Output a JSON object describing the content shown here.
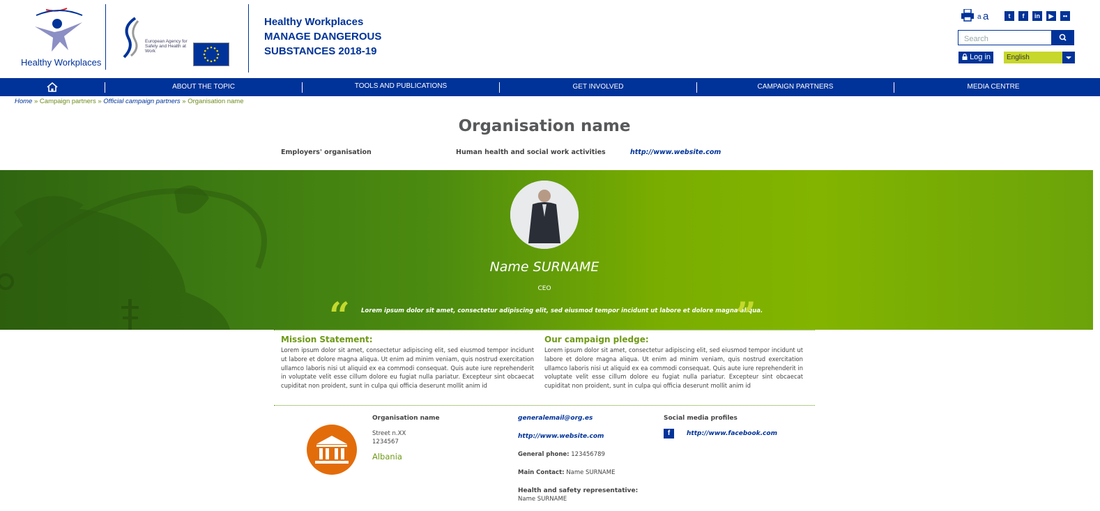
{
  "header": {
    "logo_text": "Healthy Workplaces",
    "agency_text": "European Agency for Safety and Health at Work",
    "campaign_line1": "Healthy Workplaces",
    "campaign_line2": "MANAGE DANGEROUS",
    "campaign_line3": "SUBSTANCES 2018-19",
    "font_small": "a",
    "font_large": "a",
    "search_placeholder": "Search",
    "login_label": "Log in",
    "language": "English",
    "social_icons": [
      "twitter-icon",
      "facebook-icon",
      "linkedin-icon",
      "youtube-icon",
      "flickr-icon"
    ]
  },
  "nav": {
    "items": [
      "ABOUT THE TOPIC",
      "TOOLS AND PUBLICATIONS",
      "GET INVOLVED",
      "CAMPAIGN PARTNERS",
      "MEDIA CENTRE"
    ]
  },
  "breadcrumb": {
    "home": "Home",
    "sep": "»",
    "campaign_partners": "Campaign partners",
    "official": "Official campaign partners",
    "current": "Organisation name"
  },
  "org": {
    "title": "Organisation name",
    "type": "Employers' organisation",
    "sector": "Human health and social work activities",
    "website": "http://www.website.com"
  },
  "banner": {
    "name": "Name SURNAME",
    "role": "CEO",
    "quote": "Lorem ipsum dolor sit amet, consectetur adipiscing elit, sed eiusmod tempor incidunt ut labore et dolore magna aliqua.",
    "open_quote": "“",
    "close_quote": "”"
  },
  "mission": {
    "heading": "Mission Statement:",
    "body": "Lorem ipsum dolor sit amet, consectetur adipiscing elit, sed eiusmod tempor incidunt ut labore et dolore magna aliqua. Ut enim ad minim veniam, quis nostrud exercitation ullamco laboris nisi ut aliquid ex ea commodi consequat. Quis aute iure reprehenderit in voluptate velit esse cillum dolore eu fugiat nulla pariatur. Excepteur sint obcaecat cupiditat non proident, sunt in culpa qui officia deserunt mollit anim id"
  },
  "pledge": {
    "heading": "Our campaign pledge:",
    "body": "Lorem ipsum dolor sit amet, consectetur adipiscing elit, sed eiusmod tempor incidunt ut labore et dolore magna aliqua. Ut enim ad minim veniam, quis nostrud exercitation ullamco laboris nisi ut aliquid ex ea commodi consequat. Quis aute iure reprehenderit in voluptate velit esse cillum dolore eu fugiat nulla pariatur. Excepteur sint obcaecat cupiditat non proident, sunt in culpa qui officia deserunt mollit anim id"
  },
  "contact": {
    "org_name": "Organisation name",
    "street": "Street n.XX",
    "postcode": "1234567",
    "country": "Albania",
    "email": "generalemail@org.es",
    "website": "http://www.website.com",
    "phone_label": "General phone:",
    "phone": "123456789",
    "main_contact_label": "Main Contact:",
    "main_contact": "Name SURNAME",
    "hs_rep_label": "Health and safety representative:",
    "hs_rep": "Name SURNAME",
    "social_label": "Social media profiles",
    "facebook_url": "http://www.facebook.com"
  },
  "colors": {
    "brand_blue": "#003399",
    "accent_green": "#6e9a16",
    "lime": "#c7d72b",
    "badge_orange": "#e36c0a"
  }
}
